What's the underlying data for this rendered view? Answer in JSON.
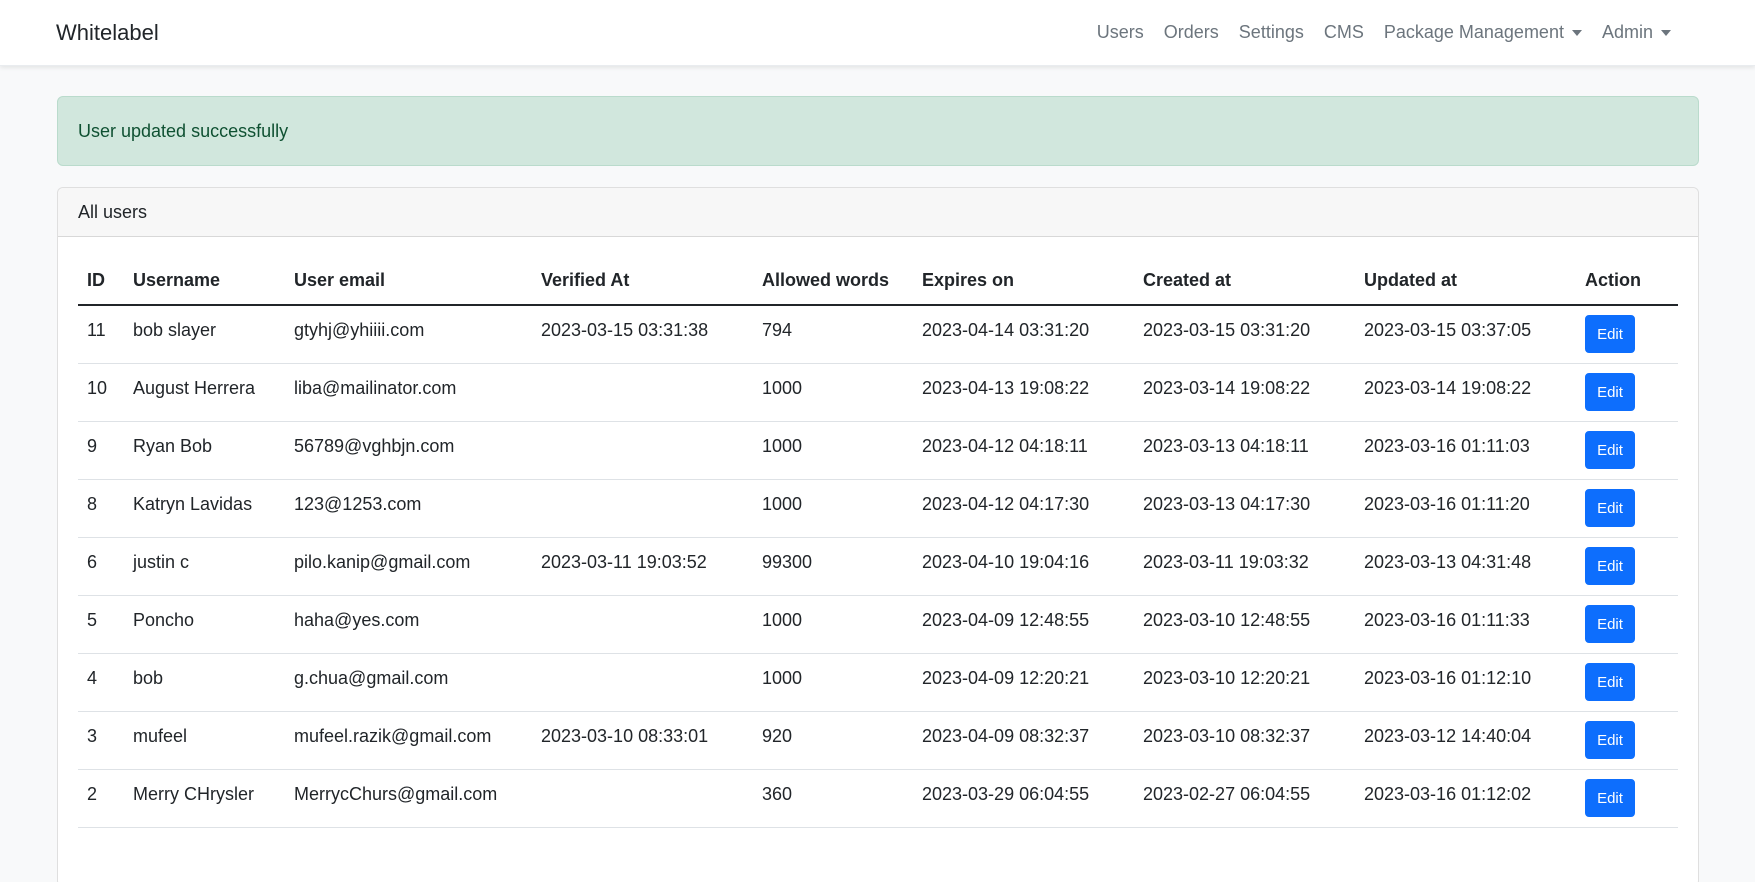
{
  "navbar": {
    "brand": "Whitelabel",
    "links": {
      "users": "Users",
      "orders": "Orders",
      "settings": "Settings",
      "cms": "CMS",
      "package_management": "Package Management",
      "admin": "Admin"
    }
  },
  "alert": {
    "message": "User updated successfully"
  },
  "card": {
    "title": "All users"
  },
  "table": {
    "headers": [
      "ID",
      "Username",
      "User email",
      "Verified At",
      "Allowed words",
      "Expires on",
      "Created at",
      "Updated at",
      "Action"
    ],
    "rows": [
      {
        "id": "11",
        "username": "bob slayer",
        "email": "gtyhj@yhiiii.com",
        "verified_at": "2023-03-15 03:31:38",
        "allowed_words": "794",
        "expires_on": "2023-04-14 03:31:20",
        "created_at": "2023-03-15 03:31:20",
        "updated_at": "2023-03-15 03:37:05",
        "action": "Edit"
      },
      {
        "id": "10",
        "username": "August Herrera",
        "email": "liba@mailinator.com",
        "verified_at": "",
        "allowed_words": "1000",
        "expires_on": "2023-04-13 19:08:22",
        "created_at": "2023-03-14 19:08:22",
        "updated_at": "2023-03-14 19:08:22",
        "action": "Edit"
      },
      {
        "id": "9",
        "username": "Ryan Bob",
        "email": "56789@vghbjn.com",
        "verified_at": "",
        "allowed_words": "1000",
        "expires_on": "2023-04-12 04:18:11",
        "created_at": "2023-03-13 04:18:11",
        "updated_at": "2023-03-16 01:11:03",
        "action": "Edit"
      },
      {
        "id": "8",
        "username": "Katryn Lavidas",
        "email": "123@1253.com",
        "verified_at": "",
        "allowed_words": "1000",
        "expires_on": "2023-04-12 04:17:30",
        "created_at": "2023-03-13 04:17:30",
        "updated_at": "2023-03-16 01:11:20",
        "action": "Edit"
      },
      {
        "id": "6",
        "username": "justin c",
        "email": "pilo.kanip@gmail.com",
        "verified_at": "2023-03-11 19:03:52",
        "allowed_words": "99300",
        "expires_on": "2023-04-10 19:04:16",
        "created_at": "2023-03-11 19:03:32",
        "updated_at": "2023-03-13 04:31:48",
        "action": "Edit"
      },
      {
        "id": "5",
        "username": "Poncho",
        "email": "haha@yes.com",
        "verified_at": "",
        "allowed_words": "1000",
        "expires_on": "2023-04-09 12:48:55",
        "created_at": "2023-03-10 12:48:55",
        "updated_at": "2023-03-16 01:11:33",
        "action": "Edit"
      },
      {
        "id": "4",
        "username": "bob",
        "email": "g.chua@gmail.com",
        "verified_at": "",
        "allowed_words": "1000",
        "expires_on": "2023-04-09 12:20:21",
        "created_at": "2023-03-10 12:20:21",
        "updated_at": "2023-03-16 01:12:10",
        "action": "Edit"
      },
      {
        "id": "3",
        "username": "mufeel",
        "email": "mufeel.razik@gmail.com",
        "verified_at": "2023-03-10 08:33:01",
        "allowed_words": "920",
        "expires_on": "2023-04-09 08:32:37",
        "created_at": "2023-03-10 08:32:37",
        "updated_at": "2023-03-12 14:40:04",
        "action": "Edit"
      },
      {
        "id": "2",
        "username": "Merry CHrysler",
        "email": "MerrycChurs@gmail.com",
        "verified_at": "",
        "allowed_words": "360",
        "expires_on": "2023-03-29 06:04:55",
        "created_at": "2023-02-27 06:04:55",
        "updated_at": "2023-03-16 01:12:02",
        "action": "Edit"
      }
    ]
  },
  "colors": {
    "primary": "#0d6efd",
    "success_bg": "#d1e7dd",
    "success_text": "#0f5132",
    "nav_link": "#6c757d"
  }
}
